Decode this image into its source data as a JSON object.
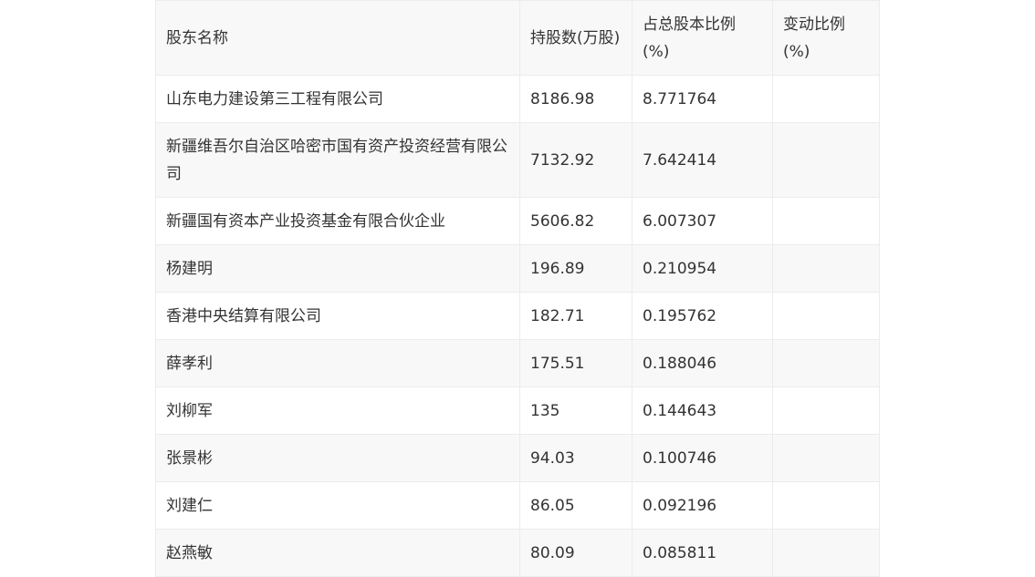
{
  "table": {
    "headers": [
      "股东名称",
      "持股数(万股)",
      "占总股本比例(%)",
      "变动比例(%)"
    ],
    "rows": [
      [
        "山东电力建设第三工程有限公司",
        "8186.98",
        "8.771764",
        ""
      ],
      [
        "新疆维吾尔自治区哈密市国有资产投资经营有限公司",
        "7132.92",
        "7.642414",
        ""
      ],
      [
        "新疆国有资本产业投资基金有限合伙企业",
        "5606.82",
        "6.007307",
        ""
      ],
      [
        "杨建明",
        "196.89",
        "0.210954",
        ""
      ],
      [
        "香港中央结算有限公司",
        "182.71",
        "0.195762",
        ""
      ],
      [
        "薛孝利",
        "175.51",
        "0.188046",
        ""
      ],
      [
        "刘柳军",
        "135",
        "0.144643",
        ""
      ],
      [
        "张景彬",
        "94.03",
        "0.100746",
        ""
      ],
      [
        "刘建仁",
        "86.05",
        "0.092196",
        ""
      ],
      [
        "赵燕敏",
        "80.09",
        "0.085811",
        ""
      ]
    ]
  }
}
